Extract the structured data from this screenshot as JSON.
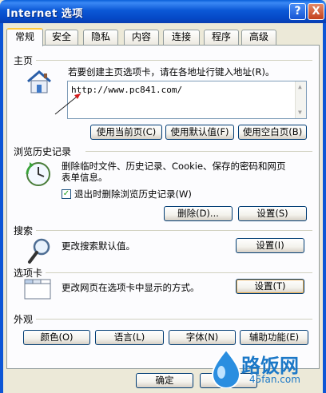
{
  "window": {
    "title": "Internet 选项",
    "help_label": "?",
    "close_label": "X"
  },
  "tabs": [
    {
      "label": "常规",
      "active": true
    },
    {
      "label": "安全"
    },
    {
      "label": "隐私"
    },
    {
      "label": "内容"
    },
    {
      "label": "连接"
    },
    {
      "label": "程序"
    },
    {
      "label": "高级"
    }
  ],
  "homepage": {
    "heading": "主页",
    "description": "若要创建主页选项卡，请在各地址行键入地址(R)。",
    "address_value": "http://www.pc841.com/",
    "buttons": {
      "use_current": "使用当前页(C)",
      "use_default": "使用默认值(F)",
      "use_blank": "使用空白页(B)"
    }
  },
  "history": {
    "heading": "浏览历史记录",
    "description_line1": "删除临时文件、历史记录、Cookie、保存的密码和网页",
    "description_line2": "表单信息。",
    "checkbox_label": "退出时删除浏览历史记录(W)",
    "checkbox_checked": true,
    "delete_button": "删除(D)...",
    "settings_button": "设置(S)"
  },
  "search": {
    "heading": "搜索",
    "description": "更改搜索默认值。",
    "settings_button": "设置(I)"
  },
  "tabs_section": {
    "heading": "选项卡",
    "description": "更改网页在选项卡中显示的方式。",
    "settings_button": "设置(T)"
  },
  "appearance": {
    "heading": "外观",
    "colors_button": "颜色(O)",
    "languages_button": "语言(L)",
    "fonts_button": "字体(N)",
    "accessibility_button": "辅助功能(E)"
  },
  "footer": {
    "ok_button": "确定"
  },
  "watermark": {
    "name": "路饭网",
    "url": "45fan.com"
  },
  "colors": {
    "titlebar": "#0b58d6",
    "dialog_bg": "#ece9d8",
    "button_border": "#003c74",
    "watermark": "#1b78c7"
  }
}
